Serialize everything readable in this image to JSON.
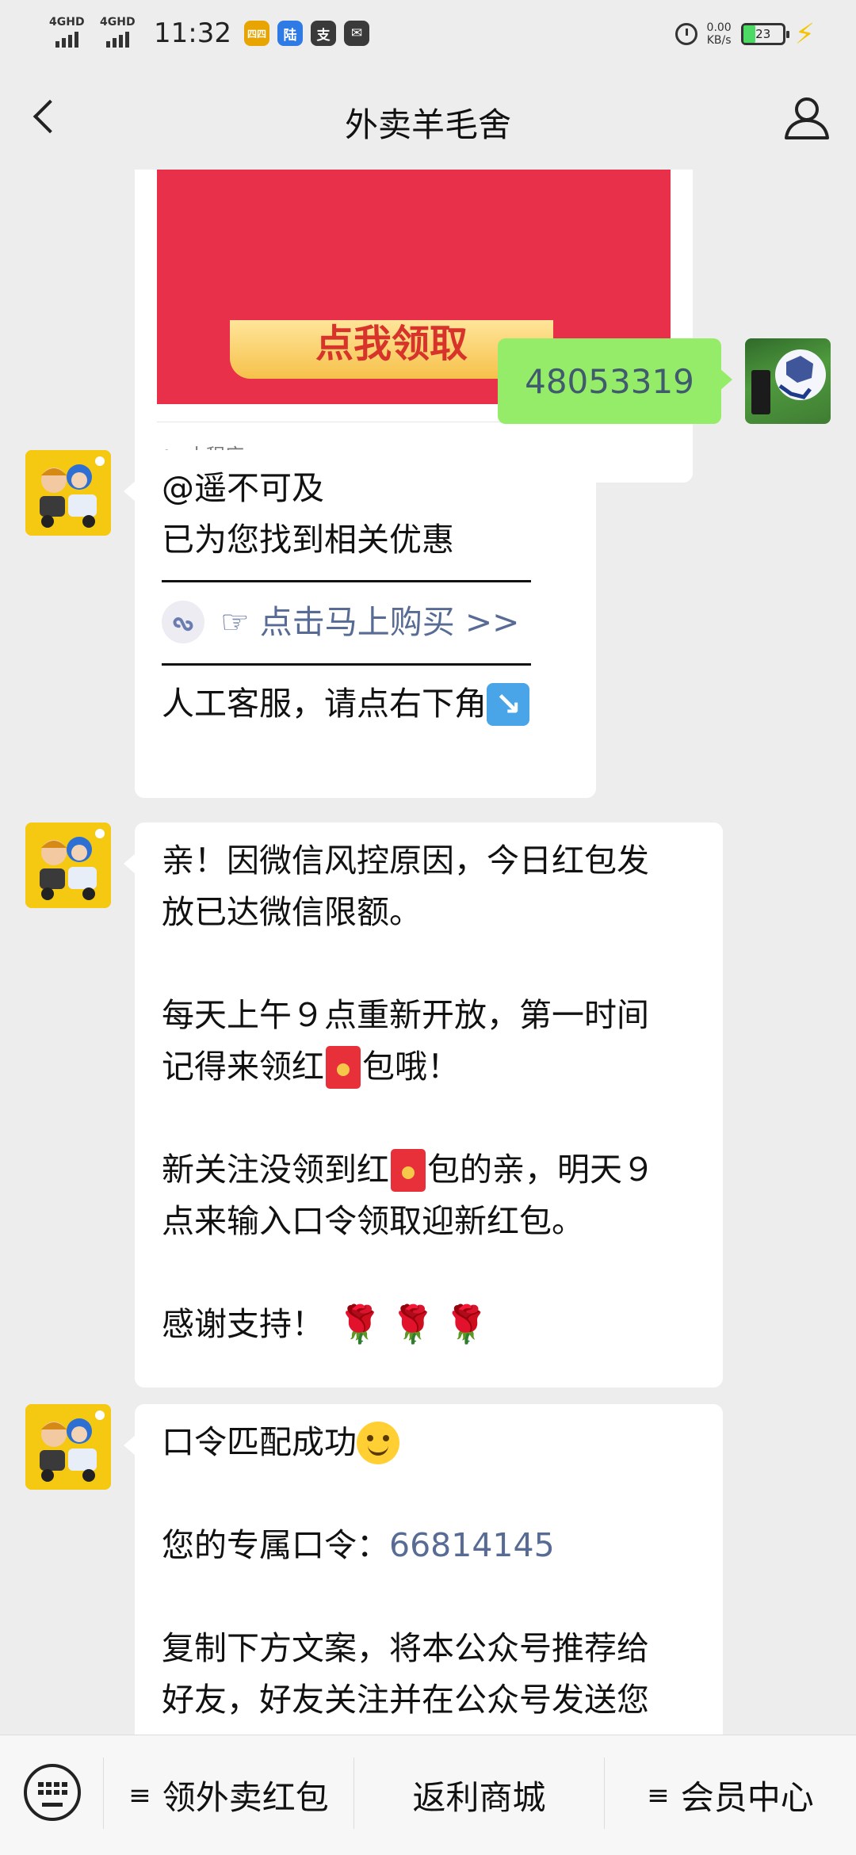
{
  "status_bar": {
    "signal1": "4GHD",
    "signal2": "4GHD",
    "time": "11:32",
    "app_icons": [
      {
        "name": "jingxi-icon",
        "label": "四四",
        "color": "#e8a400"
      },
      {
        "name": "lu-icon",
        "label": "陆",
        "color": "#2f7be5"
      },
      {
        "name": "zhi-icon",
        "label": "支",
        "color": "#3a3a3a"
      },
      {
        "name": "mail-icon",
        "label": "✉",
        "color": "#3a3a3a"
      }
    ],
    "speed_value": "0.00",
    "speed_unit": "KB/s",
    "battery": "23"
  },
  "header": {
    "title": "外卖羊毛舍"
  },
  "messages": {
    "miniprogram": {
      "button_text": "点我领取",
      "label": "小程序"
    },
    "outgoing": {
      "text": "48053319"
    },
    "reply1": {
      "line1": "@遥不可及",
      "line2": "已为您找到相关优惠",
      "link": "☞ 点击马上购买 >>",
      "line3": "人工客服，请点右下角"
    },
    "reply2": {
      "p1_l1": "亲！因微信风控原因，今日红包发",
      "p1_l2": "放已达微信限额。",
      "p2_l1": "每天上午９点重新开放，第一时间",
      "p2_l2a": "记得来领红",
      "p2_l2b": "包哦！",
      "p3_l1a": "新关注没领到红",
      "p3_l1b": "包的亲，明天９",
      "p3_l2": "点来输入口令领取迎新红包。",
      "p4": "感谢支持！"
    },
    "reply3": {
      "l1": "口令匹配成功",
      "l2_label": "您的专属口令：",
      "l2_code": "66814145",
      "l3": "复制下方文案，将本公众号推荐给",
      "l4": "好友，好友关注并在公众号发送您"
    }
  },
  "bottom_menu": {
    "items": [
      "领外卖红包",
      "返利商城",
      "会员中心"
    ],
    "hamburger": "≡"
  }
}
